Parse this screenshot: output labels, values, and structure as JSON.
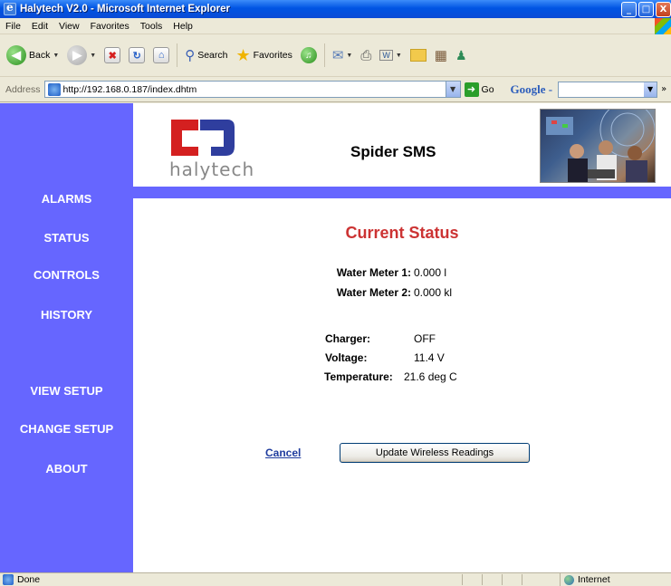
{
  "window": {
    "title": "Halytech V2.0 - Microsoft Internet Explorer",
    "minimize": "_",
    "maximize": "□",
    "close": "X"
  },
  "menu": [
    "File",
    "Edit",
    "View",
    "Favorites",
    "Tools",
    "Help"
  ],
  "toolbar": {
    "back_label": "Back",
    "search_label": "Search",
    "favorites_label": "Favorites"
  },
  "address": {
    "label": "Address",
    "url": "http://192.168.0.187/index.dhtm",
    "go_label": "Go",
    "google_label": "Google -"
  },
  "nav": {
    "items": [
      {
        "label": "ALARMS"
      },
      {
        "label": "STATUS"
      },
      {
        "label": "CONTROLS"
      },
      {
        "label": "HISTORY"
      },
      {
        "label": "VIEW SETUP"
      },
      {
        "label": "CHANGE SETUP"
      },
      {
        "label": "ABOUT"
      }
    ]
  },
  "header": {
    "logo_text": "halytech",
    "app_title": "Spider SMS",
    "logo_red": "#D42020",
    "logo_blue": "#2F3E9E"
  },
  "status": {
    "title": "Current Status",
    "water_meter_1_label": "Water Meter 1:",
    "water_meter_1_value": "0.000 l",
    "water_meter_2_label": "Water Meter 2:",
    "water_meter_2_value": "0.000 kl",
    "charger_label": "Charger:",
    "charger_value": "OFF",
    "voltage_label": "Voltage:",
    "voltage_value": "11.4 V",
    "temperature_label": "Temperature:",
    "temperature_value": "21.6 deg C"
  },
  "actions": {
    "cancel_label": "Cancel",
    "update_label": "Update Wireless Readings"
  },
  "statusbar": {
    "text": "Done",
    "zone": "Internet"
  },
  "colors": {
    "sidebar": "#6666FF",
    "title_red": "#CC3333",
    "link_blue": "#1F3C9E"
  }
}
